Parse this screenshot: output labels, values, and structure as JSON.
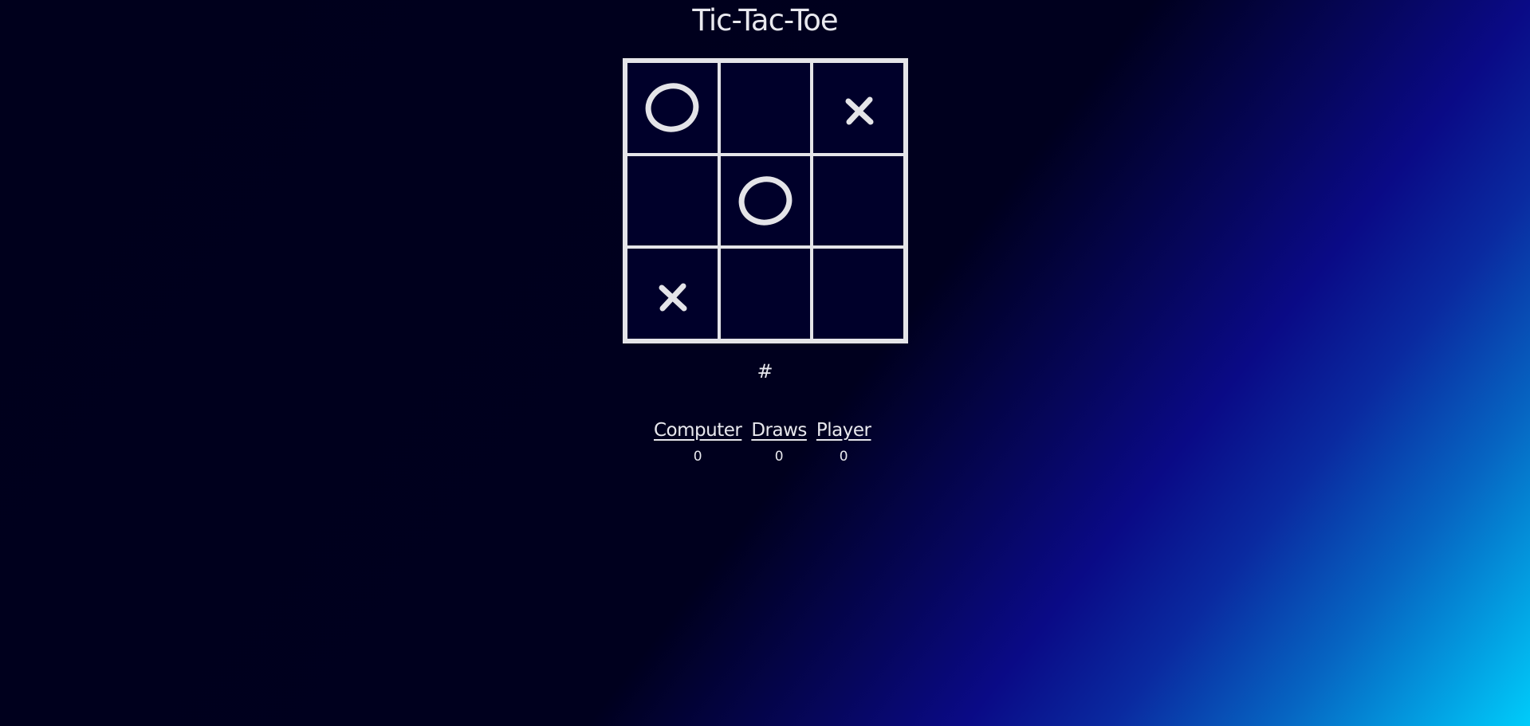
{
  "game": {
    "title": "Tic-Tac-Toe",
    "status": "#",
    "board": [
      [
        "O",
        "",
        "X"
      ],
      [
        "",
        "O",
        ""
      ],
      [
        "X",
        "",
        ""
      ]
    ]
  },
  "scores": [
    {
      "label": "Computer",
      "value": "0"
    },
    {
      "label": "Draws",
      "value": "0"
    },
    {
      "label": "Player",
      "value": "0"
    }
  ],
  "colors": {
    "mark": "#e4e4e8",
    "grid": "#e4e4e8",
    "background_dark": "#00001c",
    "background_accent": "#00ccfa"
  },
  "icons": {
    "x_mark": "x-mark-icon",
    "o_mark": "o-mark-icon"
  }
}
